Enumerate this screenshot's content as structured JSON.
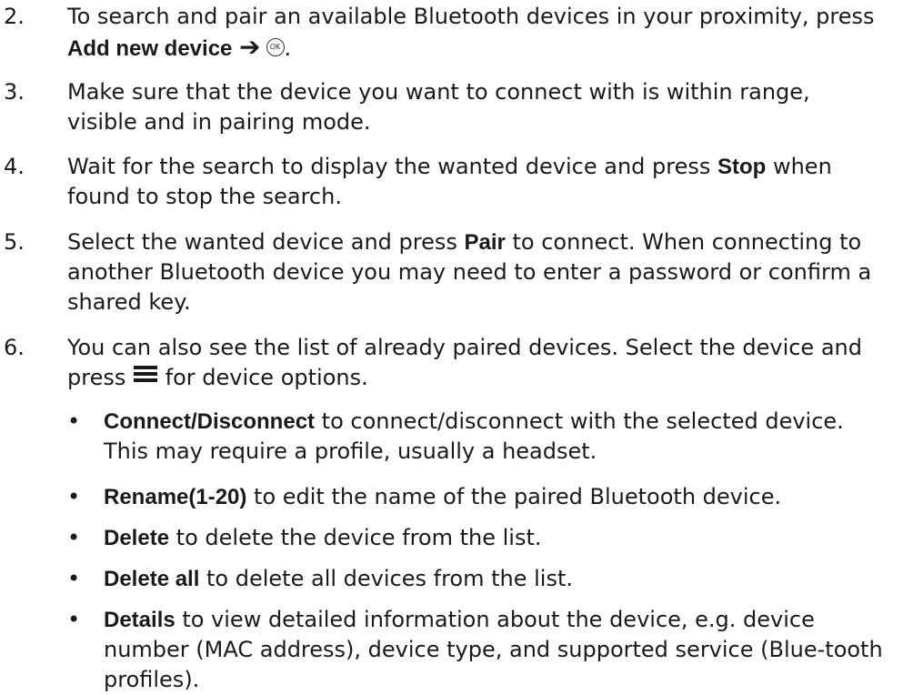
{
  "steps": [
    {
      "num": "2.",
      "pre": "To search and pair an available Bluetooth devices in your proximity, press ",
      "bold": "Add new device",
      "arrow": "➔",
      "ok_icon": "OK",
      "post": "."
    },
    {
      "num": "3.",
      "text": "Make sure that the device you want to connect with is within range, visible and in pairing mode."
    },
    {
      "num": "4.",
      "pre": "Wait for the search to display the wanted device and press ",
      "bold": "Stop",
      "post": " when found to stop the search."
    },
    {
      "num": "5.",
      "pre": "Select the wanted device and press ",
      "bold": "Pair",
      "post": " to connect. When connecting to another Bluetooth device you may need to enter a password or confirm a shared key."
    },
    {
      "num": "6.",
      "pre": "You can also see the list of already paired devices. Select the device and press ",
      "icon": "menu-icon",
      "post": " for device options."
    }
  ],
  "bullets": [
    {
      "marker": "•",
      "bold": "Connect/Disconnect",
      "text": " to connect/disconnect with the selected device. This may require a profile, usually a headset."
    },
    {
      "marker": "•",
      "bold": "Rename",
      "bold2": "(1-20)",
      "text": " to edit the name of the paired Bluetooth device."
    },
    {
      "marker": "•",
      "bold": "Delete",
      "text": " to delete the device from the list."
    },
    {
      "marker": "•",
      "bold": "Delete all",
      "text": " to delete all devices from the list."
    },
    {
      "marker": "•",
      "bold": "Details",
      "text": " to view detailed information about the device, e.g. device number (MAC address), device type, and supported service (Blue-tooth profiles)."
    }
  ]
}
